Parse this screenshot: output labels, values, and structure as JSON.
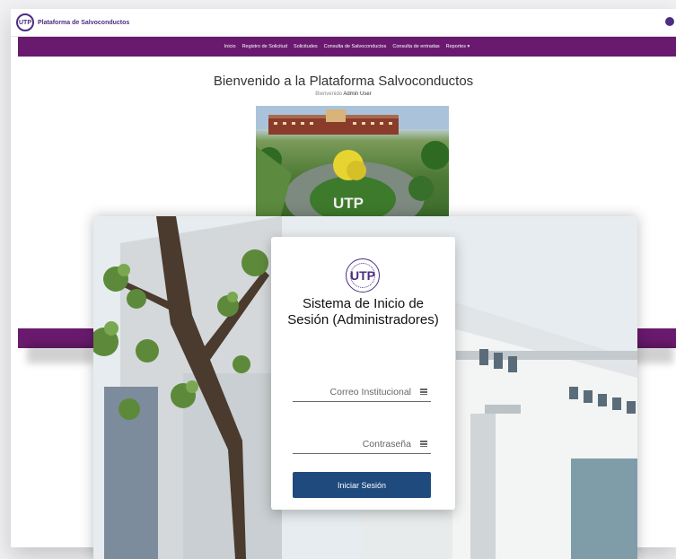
{
  "back_window": {
    "brand_logo_text": "UTP",
    "brand_name": "Plataforma de Salvoconductos",
    "nav_items": [
      "Inicio",
      "Registro de Solicitud",
      "Solicitudes",
      "Consulta de Salvoconductos",
      "Consulta de entradas",
      "Reportes ▾"
    ],
    "welcome_title": "Bienvenido a la Plataforma Salvoconductos",
    "welcome_prefix": "Bienvenido",
    "welcome_user": "Admin User",
    "photo_sign_text": "UTP"
  },
  "login": {
    "logo_text": "UTP",
    "title": "Sistema de Inicio de Sesión (Administradores)",
    "email_placeholder": "Correo Institucional",
    "password_placeholder": "Contraseña",
    "submit_label": "Iniciar Sesión"
  },
  "colors": {
    "nav_purple": "#6a1a6e",
    "brand_purple": "#4b2e83",
    "button_blue": "#1f4a7d"
  },
  "icons": [
    "user-icon",
    "email-field-icon",
    "password-field-icon"
  ]
}
